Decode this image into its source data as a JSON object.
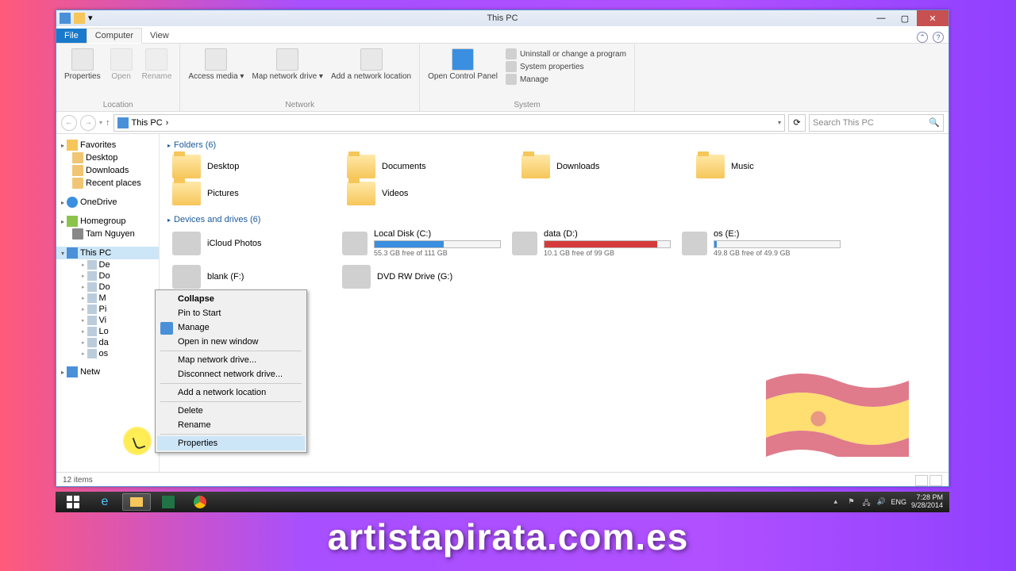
{
  "window": {
    "title": "This PC",
    "tabs": {
      "file": "File",
      "computer": "Computer",
      "view": "View"
    }
  },
  "ribbon": {
    "location": {
      "label": "Location",
      "properties": "Properties",
      "open": "Open",
      "rename": "Rename"
    },
    "network": {
      "label": "Network",
      "access_media": "Access media ▾",
      "map_drive": "Map network drive ▾",
      "add_location": "Add a network location"
    },
    "system": {
      "label": "System",
      "open_cp": "Open Control Panel",
      "uninstall": "Uninstall or change a program",
      "sysprops": "System properties",
      "manage": "Manage"
    }
  },
  "address": {
    "path": "This PC",
    "crumb_arrow": "›",
    "search_placeholder": "Search This PC"
  },
  "sidebar": {
    "favorites": {
      "label": "Favorites",
      "items": [
        "Desktop",
        "Downloads",
        "Recent places"
      ]
    },
    "onedrive": "OneDrive",
    "homegroup": {
      "label": "Homegroup",
      "user": "Tam Nguyen"
    },
    "thispc": {
      "label": "This PC",
      "children": [
        "De",
        "Do",
        "Do",
        "M",
        "Pi",
        "Vi",
        "Lo",
        "da",
        "os"
      ]
    },
    "network": "Netw"
  },
  "content": {
    "folders_header": "Folders (6)",
    "folders": [
      "Desktop",
      "Documents",
      "Downloads",
      "Music",
      "Pictures",
      "Videos"
    ],
    "drives_header": "Devices and drives (6)",
    "drives": [
      {
        "name": "iCloud Photos",
        "type": "app"
      },
      {
        "name": "Local Disk (C:)",
        "sub": "55.3 GB free of 111 GB",
        "fill": 55,
        "color": "#3a8fe0"
      },
      {
        "name": "data (D:)",
        "sub": "10.1 GB free of 99 GB",
        "fill": 90,
        "color": "#d63b3b"
      },
      {
        "name": "os (E:)",
        "sub": "49.8 GB free of 49.9 GB",
        "fill": 2,
        "color": "#3a8fe0"
      },
      {
        "name": "blank (F:)",
        "type": "plain"
      },
      {
        "name": "DVD RW Drive (G:)",
        "type": "optical"
      }
    ]
  },
  "context_menu": {
    "items": [
      {
        "label": "Collapse",
        "bold": true
      },
      {
        "label": "Pin to Start"
      },
      {
        "label": "Manage",
        "icon": true
      },
      {
        "label": "Open in new window"
      },
      {
        "sep": true
      },
      {
        "label": "Map network drive..."
      },
      {
        "label": "Disconnect network drive..."
      },
      {
        "sep": true
      },
      {
        "label": "Add a network location"
      },
      {
        "sep": true
      },
      {
        "label": "Delete"
      },
      {
        "label": "Rename"
      },
      {
        "sep": true
      },
      {
        "label": "Properties",
        "hl": true
      }
    ]
  },
  "statusbar": {
    "count": "12 items"
  },
  "tray": {
    "lang": "ENG",
    "time": "7:28 PM",
    "date": "9/28/2014"
  },
  "watermark": "artistapirata.com.es"
}
